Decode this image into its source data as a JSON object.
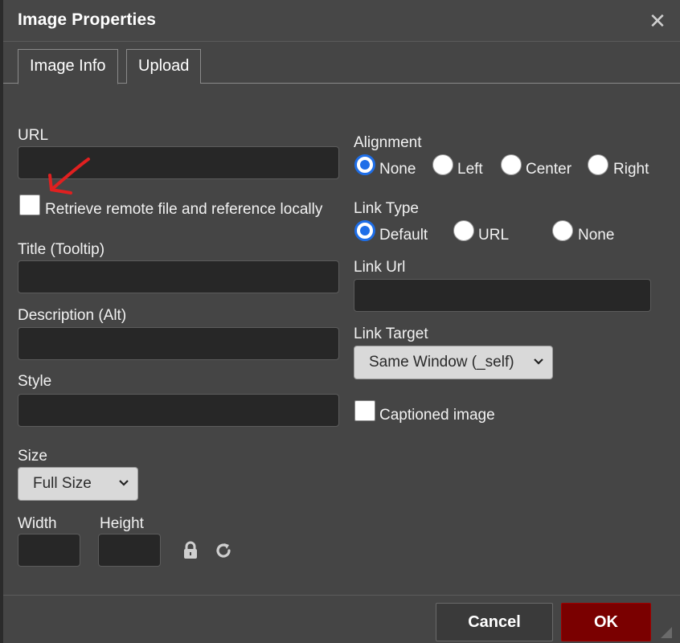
{
  "dialog": {
    "title": "Image Properties",
    "close_glyph": "✕"
  },
  "tabs": [
    {
      "label": "Image Info",
      "active": true
    },
    {
      "label": "Upload",
      "active": false
    }
  ],
  "left": {
    "url_label": "URL",
    "url_value": "",
    "retrieve_label": "Retrieve remote file and reference locally",
    "retrieve_checked": false,
    "title_label": "Title (Tooltip)",
    "title_value": "",
    "description_label": "Description (Alt)",
    "description_value": "",
    "style_label": "Style",
    "style_value": "",
    "size_label": "Size",
    "size_selected": "Full Size",
    "width_label": "Width",
    "width_value": "",
    "height_label": "Height",
    "height_value": "",
    "lock_icon": "lock-icon",
    "reset_icon": "refresh-icon"
  },
  "right": {
    "alignment_label": "Alignment",
    "alignment_options": [
      "None",
      "Left",
      "Center",
      "Right"
    ],
    "alignment_selected": "None",
    "link_type_label": "Link Type",
    "link_type_options": [
      "Default",
      "URL",
      "None"
    ],
    "link_type_selected": "Default",
    "link_url_label": "Link Url",
    "link_url_value": "",
    "link_target_label": "Link Target",
    "link_target_selected": "Same Window (_self)",
    "captioned_label": "Captioned image",
    "captioned_checked": false
  },
  "footer": {
    "cancel_label": "Cancel",
    "ok_label": "OK"
  },
  "colors": {
    "dialog_bg": "#454545",
    "input_bg": "#272727",
    "ok_bg": "#7a0000",
    "radio_accent": "#1e6ee8",
    "annotation_arrow": "#e02020"
  }
}
